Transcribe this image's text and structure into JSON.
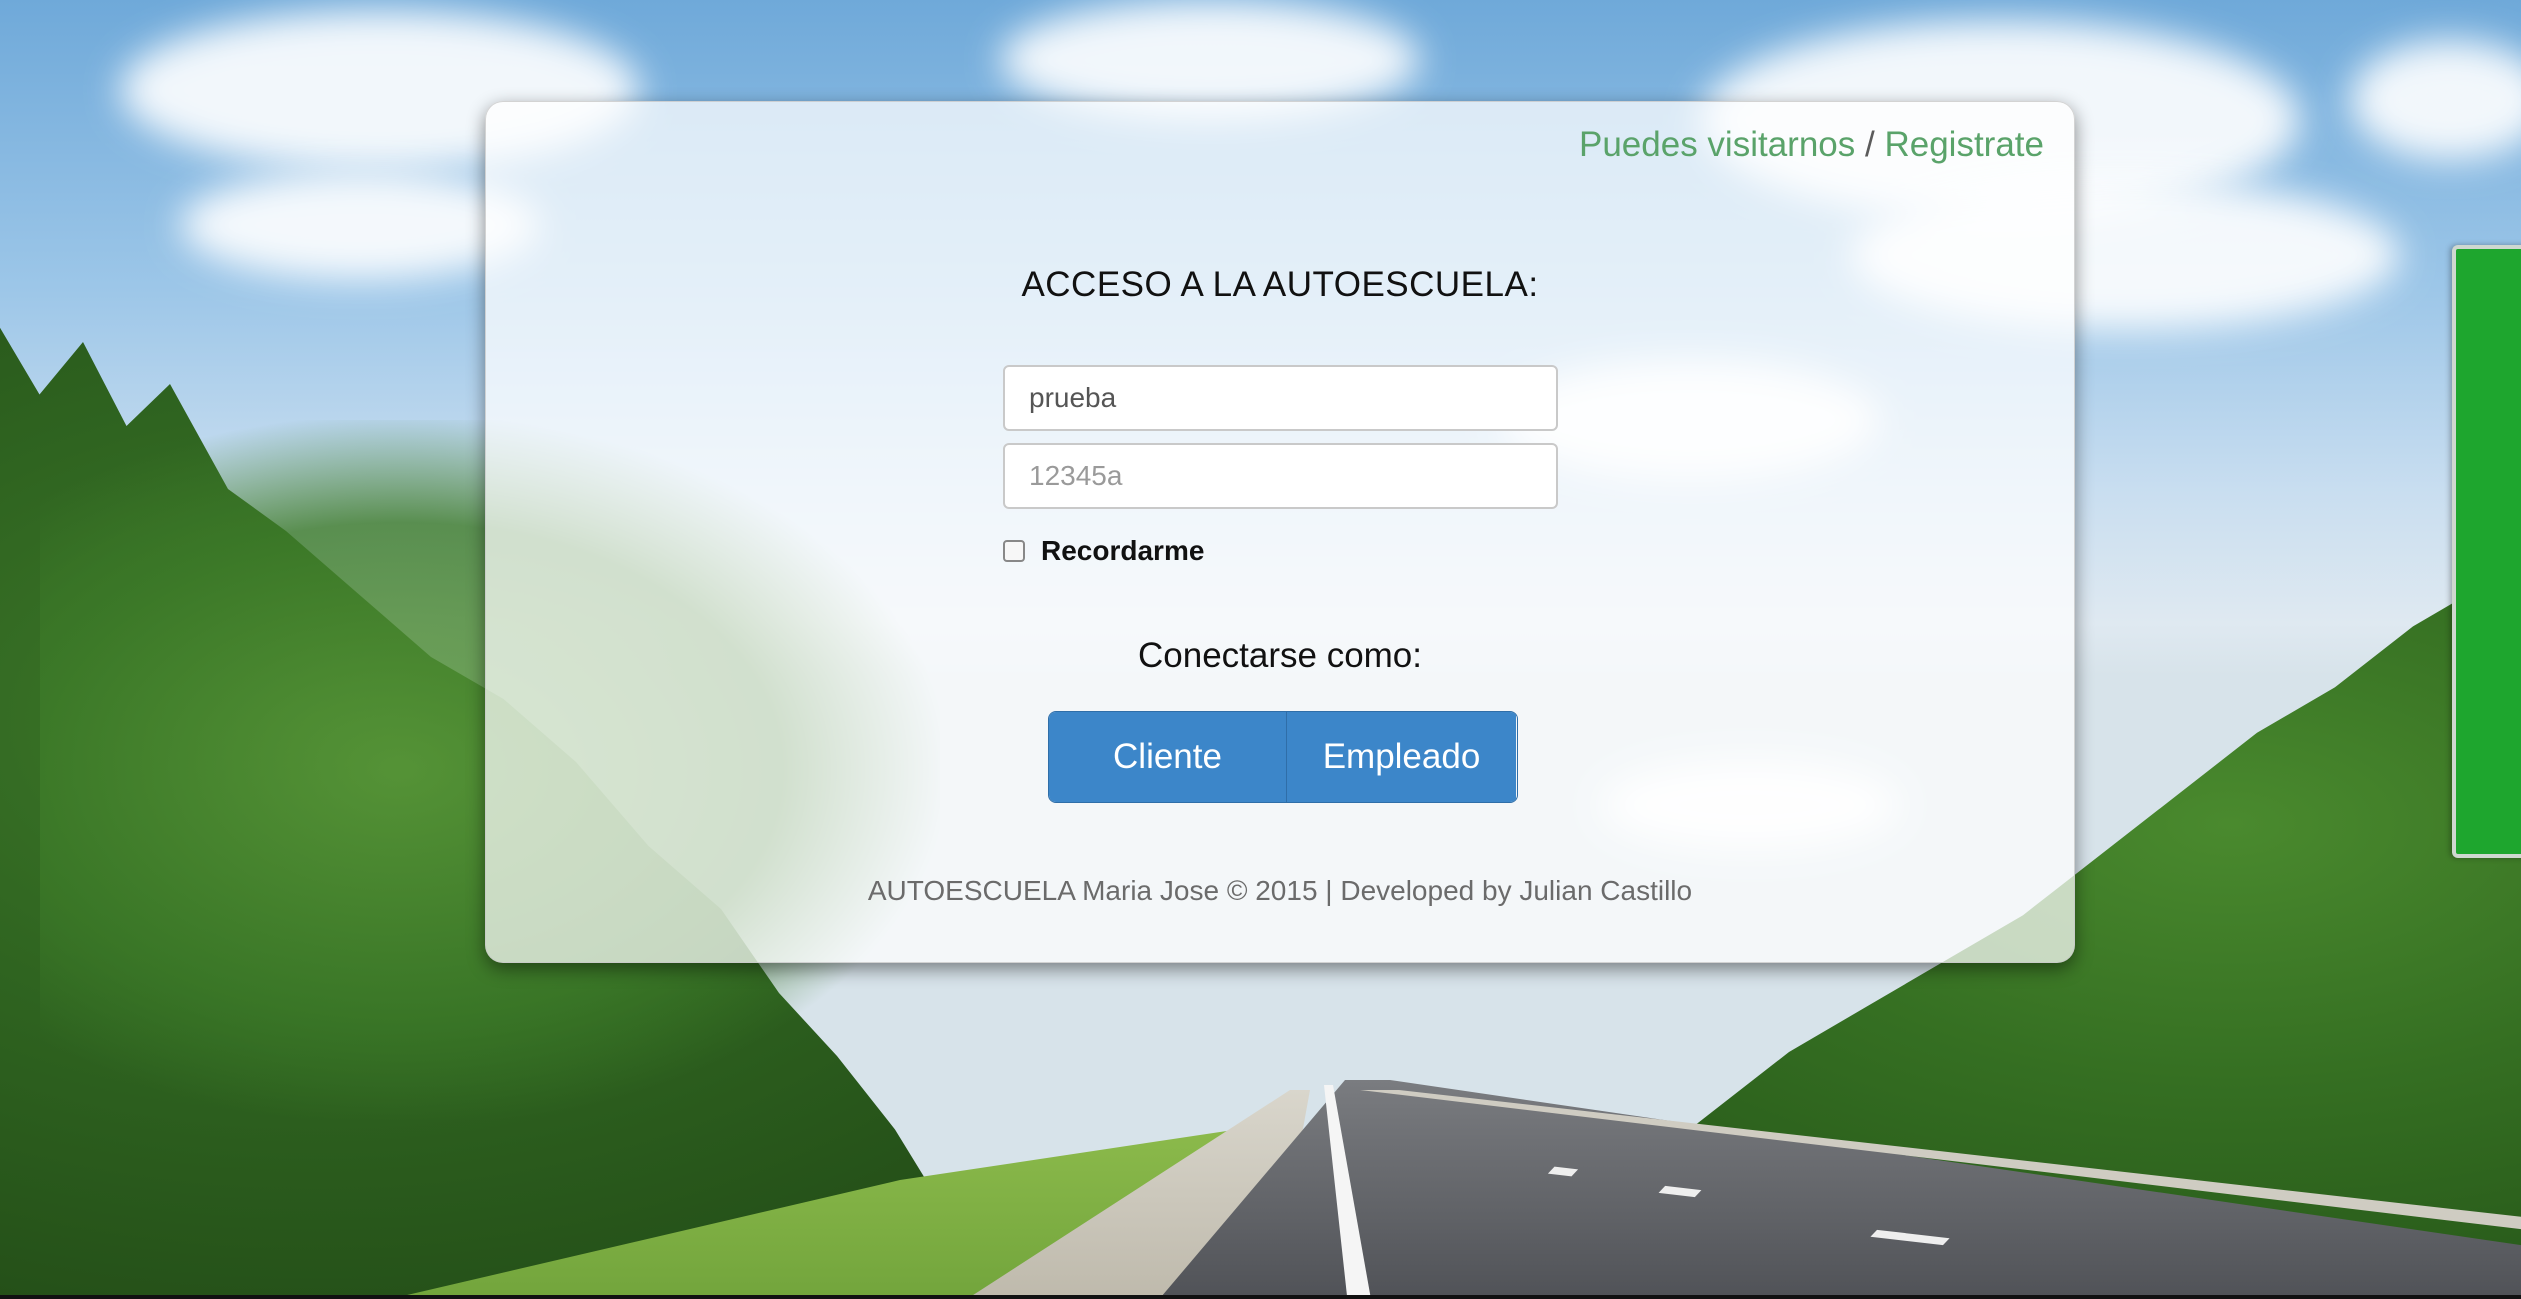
{
  "header": {
    "visit_link": "Puedes visitarnos",
    "separator": "/",
    "register_link": "Registrate"
  },
  "login": {
    "title": "ACCESO A LA AUTOESCUELA:",
    "username_value": "prueba",
    "password_placeholder": "12345a",
    "remember_label": "Recordarme",
    "remember_checked": false,
    "connect_as_label": "Conectarse como:",
    "buttons": {
      "client": "Cliente",
      "employee": "Empleado"
    }
  },
  "footer": {
    "text": "AUTOESCUELA Maria Jose © 2015 | Developed by Julian Castillo"
  },
  "colors": {
    "link_green": "#5aa36a",
    "button_blue": "#3c86c9",
    "sign_green": "#1ea62e"
  }
}
